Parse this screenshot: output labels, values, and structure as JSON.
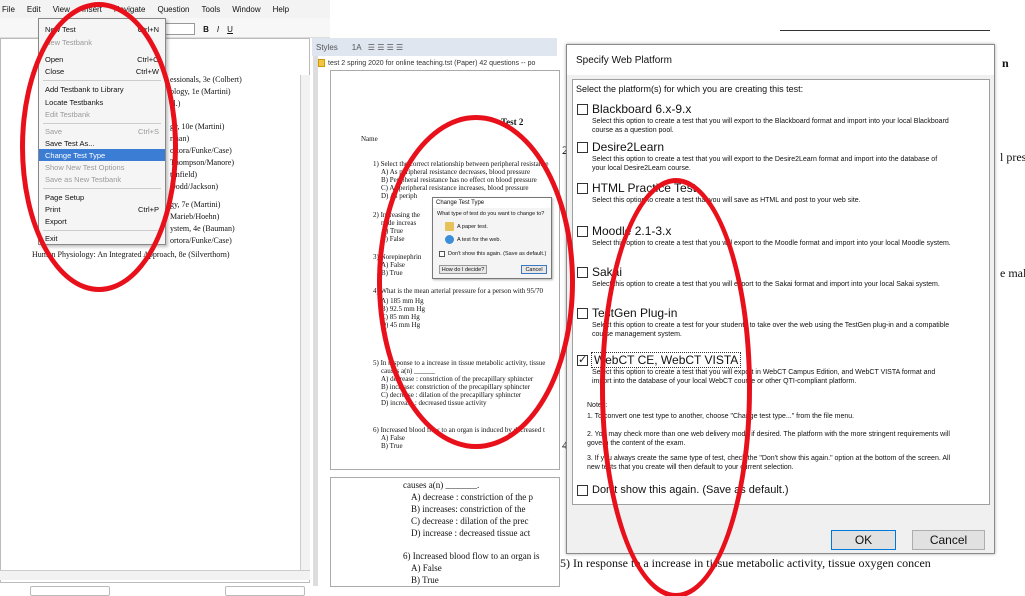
{
  "menubar": {
    "items": [
      "File",
      "Edit",
      "View",
      "Insert",
      "Navigate",
      "Question",
      "Tools",
      "Window",
      "Help"
    ]
  },
  "file_menu": {
    "items": [
      {
        "label": "New Test",
        "shortcut": "Ctrl+N",
        "disabled": false
      },
      {
        "label": "New Testbank",
        "shortcut": "",
        "disabled": true
      },
      {
        "label": "Open",
        "shortcut": "Ctrl+O",
        "disabled": false
      },
      {
        "label": "Close",
        "shortcut": "Ctrl+W",
        "disabled": false
      },
      {
        "label": "Add Testbank to Library",
        "shortcut": "",
        "disabled": false
      },
      {
        "label": "Locate Testbanks",
        "shortcut": "",
        "disabled": false
      },
      {
        "label": "Edit Testbank",
        "shortcut": "",
        "disabled": true
      },
      {
        "label": "Save",
        "shortcut": "Ctrl+S",
        "disabled": true
      },
      {
        "label": "Save Test As...",
        "shortcut": "",
        "disabled": false
      },
      {
        "label": "Change Test Type",
        "shortcut": "",
        "disabled": false,
        "selected": true
      },
      {
        "label": "Show New Test Options",
        "shortcut": "",
        "disabled": true
      },
      {
        "label": "Save as New Testbank",
        "shortcut": "",
        "disabled": true
      },
      {
        "label": "Page Setup",
        "shortcut": "",
        "disabled": false
      },
      {
        "label": "Print",
        "shortcut": "Ctrl+P",
        "disabled": false
      },
      {
        "label": "Export",
        "shortcut": "",
        "disabled": false
      },
      {
        "label": "Exit",
        "shortcut": "",
        "disabled": false
      }
    ]
  },
  "toolbar": {
    "styles_tab": "Styles",
    "bold": "B",
    "italic": "I",
    "underline": "U"
  },
  "doc_tab": {
    "title": "test 2 spring 2020 for online teaching.tst (Paper)   42 questions -- po"
  },
  "testbank_list": [
    "essionals, 3e  (Colbert)",
    "ology, 1e (Martini)",
    "al.)",
    "gy, 10e (Martini)",
    "rman)",
    "ortora/Funke/Case)",
    "Thompson/Manore)",
    "tanfield)",
    "Dodd/Jackson)",
    "gy, 7e (Martini)",
    "Marieb/Hoehn)",
    "ystem, 4e (Bauman)",
    "ortora/Funke/Case)",
    "Human Physiology: An Integrated Approach, 8e (Silverthorn)"
  ],
  "page": {
    "title": "Test 2",
    "name_label": "Name",
    "lines": [
      "1) Select the correct relationship between peripheral resistance",
      "A) As peripheral resistance decreases, blood pressure",
      "B) Peripheral resistance has no effect on blood pressure",
      "C) As peripheral resistance increases, blood pressure",
      "D) As periph",
      "2) Increasing the",
      "node increas",
      "A) True",
      "B) False",
      "3) Norepinephrin",
      "A) False",
      "B) True",
      "4) What is the mean arterial pressure for a person with 95/70",
      "A) 185 mm Hg",
      "B) 92.5 mm Hg",
      "C) 85 mm Hg",
      "D) 45 mm Hg",
      "5) In response to a increase in tissue metabolic activity, tissue",
      "causes a(n) ______",
      "A) decrease : constriction of the precapillary sphincter",
      "B) increase: constriction of the precapillary sphincter",
      "C) decrease : dilation of the precapillary sphincter",
      "D) increase : decreased tissue activity",
      "6) Increased blood flow to an organ is induced by decreased t",
      "A) False",
      "B) True"
    ]
  },
  "page2": {
    "lines": [
      "causes a(n) _______.",
      "A) decrease : constriction of the p",
      "B) increases: constriction of the",
      "C) decrease : dilation of the  prec",
      "D) increase :  decreased tissue act",
      "6) Increased blood flow to an organ is",
      "A) False",
      "B) True"
    ]
  },
  "change_test_type_dialog": {
    "title": "Change Test Type",
    "prompt": "What type of test do you want to change to?",
    "option_paper": "A paper test.",
    "option_web": "A test for the web.",
    "dont_show": "Don't show this again. (Save as default.)",
    "how_decide": "How do I decide?",
    "cancel": "Cancel"
  },
  "background_right": {
    "line1": "n",
    "line2": "l pres",
    "line3": "e mal",
    "line4": "5) In response to a increase in tissue metabolic activity, tissue oxygen concen",
    "q2": "2",
    "q4": "4"
  },
  "dialog": {
    "title": "Specify Web Platform",
    "instruction": "Select the platform(s) for which you are creating this test:",
    "options": [
      {
        "label": "Blackboard 6.x-9.x",
        "checked": false,
        "desc": "Select this option to create a test that you will export to the Blackboard format and import into your local Blackboard course as a question pool."
      },
      {
        "label": "Desire2Learn",
        "checked": false,
        "desc": "Select this option to create a test that you will export to the Desire2Learn format and import into the database of your local Desire2Learn course."
      },
      {
        "label": "HTML Practice Test",
        "checked": false,
        "desc": "Select this option to create a test that you will save as HTML and post to your web site."
      },
      {
        "label": "Moodle 2.1-3.x",
        "checked": false,
        "desc": "Select this option to create a test that you will export to the Moodle format and import into your local Moodle system."
      },
      {
        "label": "Sakai",
        "checked": false,
        "desc": "Select this option to create a test that you will export to the Sakai format and import into your local Sakai system."
      },
      {
        "label": "TestGen Plug-in",
        "checked": false,
        "desc": "Select this option to create a test for your students to take over the web using the TestGen plug-in and a compatible course management system."
      },
      {
        "label": "WebCT CE, WebCT VISTA",
        "checked": true,
        "desc": "Select this option to create a test that you will export in WebCT Campus Edition, and WebCT VISTA format and import into the database of your local WebCT course or other QTI-compliant platform."
      }
    ],
    "notes_title": "Notes:",
    "notes": [
      "1. To convert one test type to another, choose \"Change test type...\" from the file menu.",
      "2. You may check more than one web delivery mode if desired. The platform with the more stringent requirements will govern the content of the exam.",
      "3. If you always create the same type of test, check the \"Don't show this again.\" option at the bottom of the screen. All new tests that you create will then default to your current selection."
    ],
    "dont_show": "Don't show this again. (Save as default.)",
    "ok": "OK",
    "cancel": "Cancel"
  },
  "colors": {
    "menu_highlight": "#3b7cd4",
    "annotation_red": "#e8101a"
  }
}
